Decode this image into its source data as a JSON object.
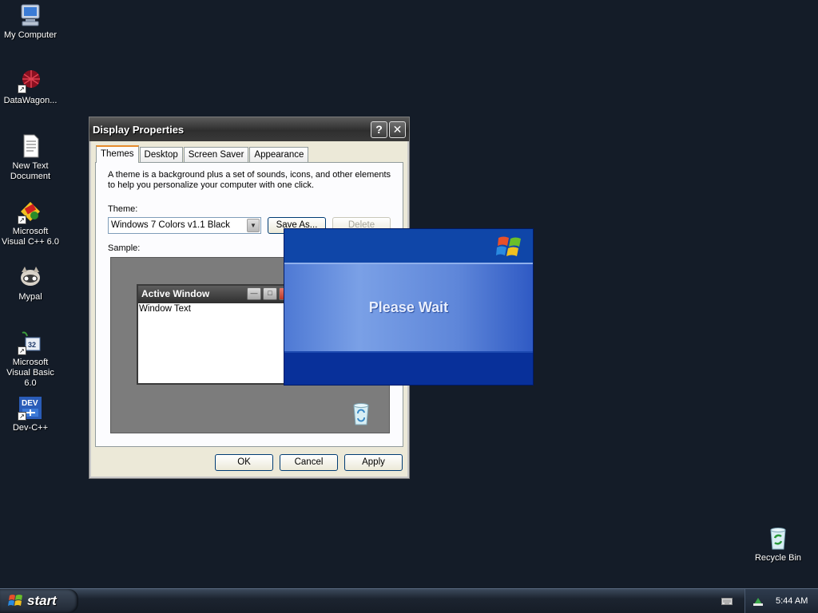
{
  "desktop_icons": [
    {
      "label": "My Computer",
      "icon": "my-computer-icon"
    },
    {
      "label": "DataWagon...",
      "icon": "datawagon-icon"
    },
    {
      "label": "New Text Document",
      "icon": "text-document-icon"
    },
    {
      "label": "Microsoft Visual C++ 6.0",
      "icon": "visual-cpp-icon"
    },
    {
      "label": "Mypal",
      "icon": "mypal-browser-icon"
    },
    {
      "label": "Microsoft Visual Basic 6.0",
      "icon": "visual-basic-icon"
    },
    {
      "label": "Dev-C++",
      "icon": "dev-cpp-icon"
    },
    {
      "label": "Recycle Bin",
      "icon": "recycle-bin-icon"
    }
  ],
  "dialog": {
    "title": "Display Properties",
    "help_btn": "?",
    "close_btn": "✕",
    "tabs": [
      "Themes",
      "Desktop",
      "Screen Saver",
      "Appearance"
    ],
    "active_tab": "Themes",
    "description": "A theme is a background plus a set of sounds, icons, and other elements to help you personalize your computer with one click.",
    "theme_label": "Theme:",
    "theme_value": "Windows 7 Colors v1.1 Black",
    "save_as_label": "Save As...",
    "delete_label": "Delete",
    "sample_label": "Sample:",
    "sample_window_title": "Active Window",
    "sample_window_text": "Window Text",
    "ok_label": "OK",
    "cancel_label": "Cancel",
    "apply_label": "Apply"
  },
  "splash": {
    "message": "Please Wait"
  },
  "taskbar": {
    "start_label": "start",
    "clock": "5:44 AM"
  },
  "colors": {
    "desktop_bg": "#141c28",
    "title_bar": "#3a3a3a",
    "splash_blue": "#0a3fa0",
    "tab_accent": "#e68b2c"
  }
}
